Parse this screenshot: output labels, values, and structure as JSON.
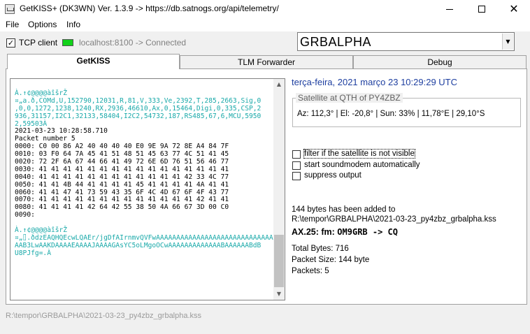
{
  "window": {
    "title": "GetKISS+ (DK3WN) Ver. 1.3.9 -> https://db.satnogs.org/api/telemetry/",
    "minimize_glyph": "",
    "maximize_glyph": "",
    "close_glyph": "✕"
  },
  "menu": [
    "File",
    "Options",
    "Info"
  ],
  "connection": {
    "tcp_client_label": "TCP client",
    "tcp_client_checked": true,
    "check_mark": "✓",
    "status_color": "#12d21a",
    "status_text": "localhost:8100 -> Connected"
  },
  "satellite_select": {
    "value": "GRBALPHA",
    "arrow": "▼"
  },
  "tabs": [
    {
      "label": "GetKISS",
      "active": true
    },
    {
      "label": "TLM Forwarder",
      "active": false
    },
    {
      "label": "Debug",
      "active": false
    }
  ],
  "kiss_log": [
    {
      "text": "À.↑¢@@@@àîšrŽ",
      "color": "teal"
    },
    {
      "text": "¤„a.ð,COMd,U,152790,12031,R,81,V,333,Ve,2392,T,285,2663,Sig,0",
      "color": "teal"
    },
    {
      "text": ",0,0,1272,1238,1240,RX,2936,46610,Ax,0,15464,Digi,0,335,CSP,2",
      "color": "teal"
    },
    {
      "text": "936,31157,I2C1,32133,58404,I2C2,54732,187,RS485,67,6,MCU,5950",
      "color": "teal"
    },
    {
      "text": "2,59503À",
      "color": "teal"
    },
    {
      "text": "2021-03-23 10:28:58.710",
      "color": "black"
    },
    {
      "text": "Packet number 5",
      "color": "black"
    },
    {
      "text": "0000: C0 00 86 A2 40 40 40 40 E0 9E 9A 72 8E A4 84 7F",
      "color": "black"
    },
    {
      "text": "0010: 03 F0 64 7A 45 41 51 48 51 45 63 77 4C 51 41 45",
      "color": "black"
    },
    {
      "text": "0020: 72 2F 6A 67 44 66 41 49 72 6E 6D 76 51 56 46 77",
      "color": "black"
    },
    {
      "text": "0030: 41 41 41 41 41 41 41 41 41 41 41 41 41 41 41 41",
      "color": "black"
    },
    {
      "text": "0040: 41 41 41 41 41 41 41 41 41 41 41 41 42 33 4C 77",
      "color": "black"
    },
    {
      "text": "0050: 41 41 4B 44 41 41 41 41 45 41 41 41 41 4A 41 41",
      "color": "black"
    },
    {
      "text": "0060: 41 41 47 41 73 59 43 35 6F 4C 4D 67 6F 4F 43 77",
      "color": "black"
    },
    {
      "text": "0070: 41 41 41 41 41 41 41 41 41 41 41 41 41 42 41 41",
      "color": "black"
    },
    {
      "text": "0080: 41 41 41 41 42 64 42 55 38 50 4A 66 67 3D 00 C0",
      "color": "black"
    },
    {
      "text": "0090:",
      "color": "black"
    },
    {
      "text": "",
      "color": "black"
    },
    {
      "text": "À.↑¢@@@@àîšrŽ",
      "color": "teal"
    },
    {
      "text": "¤„⌷.ðdzEAQHQEcwLQAEr/jgDfAIrnmvQVFwAAAAAAAAAAAAAAAAAAAAAAAAAAAAA",
      "color": "teal"
    },
    {
      "text": "AAB3LwAAKDAAAAEAAAAJAAAAGAsYC5oLMgoOCwAAAAAAAAAAAAABAAAAAABdB",
      "color": "teal"
    },
    {
      "text": "U8PJfg=.À",
      "color": "teal"
    }
  ],
  "scrollbar": {
    "up_arrow": "▲",
    "down_arrow": "▼"
  },
  "datetime": "terça-feira, 2021 março 23  10:29:29 UTC",
  "qth": {
    "legend": "Satellite at QTH of PY4ZBZ",
    "values": "Az: 112,3° | El: -20,8° | Sun: 33% | 11,78°E | 29,10°S"
  },
  "options": [
    {
      "label": "filter if the satellite is not visible",
      "checked": false
    },
    {
      "label": "start soundmodem automatically",
      "checked": false
    },
    {
      "label": "suppress output",
      "checked": false
    }
  ],
  "info": {
    "added_line": "144 bytes has been added to",
    "file_path": "R:\\tempor\\GRBALPHA\\2021-03-23_py4zbz_grbalpha.kss",
    "ax25_prefix": "AX.25: fm: ",
    "ax25_route": "OM9GRB -> CQ",
    "total_bytes": "Total Bytes: 716",
    "packet_size": "Packet Size: 144 byte",
    "packets": "Packets: 5"
  },
  "statusbar": "R:\\tempor\\GRBALPHA\\2021-03-23_py4zbz_grbalpha.kss"
}
